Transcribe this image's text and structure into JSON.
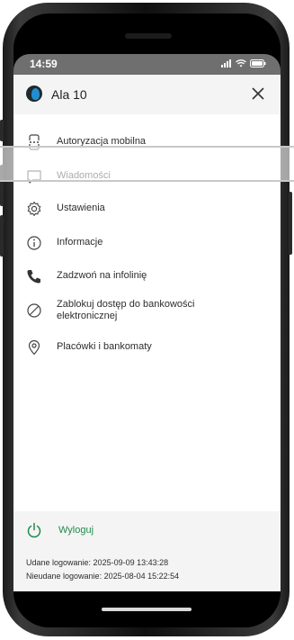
{
  "status_bar": {
    "time": "14:59"
  },
  "header": {
    "username": "Ala 10"
  },
  "menu": [
    {
      "label": "Autoryzacja mobilna",
      "icon": "mobile-authorization-icon"
    },
    {
      "label": "Wiadomości",
      "icon": "message-icon"
    },
    {
      "label": "Ustawienia",
      "icon": "gear-icon"
    },
    {
      "label": "Informacje",
      "icon": "info-icon"
    },
    {
      "label": "Zadzwoń na infolinię",
      "icon": "phone-icon"
    },
    {
      "label": "Zablokuj dostęp do bankowości elektronicznej",
      "icon": "block-icon"
    },
    {
      "label": "Placówki i bankomaty",
      "icon": "location-pin-icon"
    }
  ],
  "footer": {
    "logout_label": "Wyloguj",
    "successful_login": "Udane logowanie: 2025-09-09 13:43:28",
    "failed_login": "Nieudane logowanie: 2025-08-04 15:22:54"
  },
  "colors": {
    "accent": "#1f8a4c",
    "panel": "#f4f4f4",
    "text": "#2d2d2d"
  }
}
